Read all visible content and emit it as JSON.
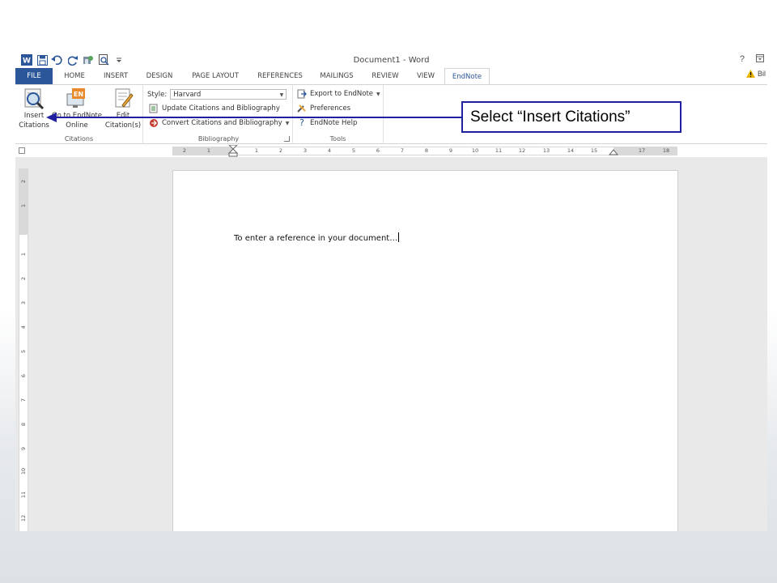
{
  "window": {
    "title": "Document1 - Word",
    "help": "?",
    "account_name": "Bil"
  },
  "tabs": [
    {
      "label": "FILE"
    },
    {
      "label": "HOME"
    },
    {
      "label": "INSERT"
    },
    {
      "label": "DESIGN"
    },
    {
      "label": "PAGE LAYOUT"
    },
    {
      "label": "REFERENCES"
    },
    {
      "label": "MAILINGS"
    },
    {
      "label": "REVIEW"
    },
    {
      "label": "VIEW"
    },
    {
      "label": "EndNote"
    }
  ],
  "ribbon": {
    "citations": {
      "group_label": "Citations",
      "insert_line1": "Insert",
      "insert_line2": "Citations",
      "goto_line1": "Go to EndNote",
      "goto_line2": "Online",
      "edit_line1": "Edit",
      "edit_line2": "Citation(s)"
    },
    "bibliography": {
      "group_label": "Bibliography",
      "style_label": "Style:",
      "style_value": "Harvard",
      "update": "Update Citations and Bibliography",
      "convert": "Convert Citations and Bibliography"
    },
    "tools": {
      "group_label": "Tools",
      "export": "Export to EndNote",
      "preferences": "Preferences",
      "help": "EndNote Help"
    }
  },
  "ruler": {
    "h_labels": [
      "2",
      "1",
      "1",
      "2",
      "3",
      "4",
      "5",
      "6",
      "7",
      "8",
      "9",
      "10",
      "11",
      "12",
      "13",
      "14",
      "15",
      "17",
      "18"
    ],
    "v_labels": [
      "2",
      "1",
      "1",
      "2",
      "3",
      "4",
      "5",
      "6",
      "7",
      "8",
      "9",
      "10",
      "11",
      "12"
    ]
  },
  "document": {
    "text": "To enter a reference in your document…"
  },
  "callout": {
    "text": "Select “Insert Citations”"
  },
  "colors": {
    "file_tab": "#2b579a",
    "callout_border": "#1f1fa0"
  }
}
